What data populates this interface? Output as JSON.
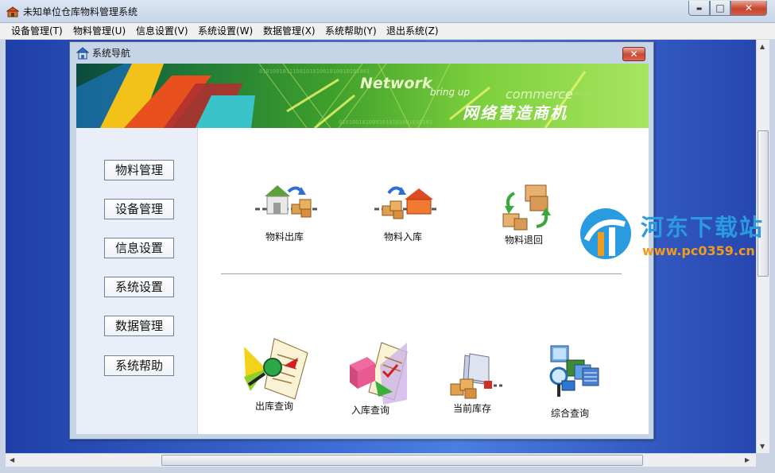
{
  "window": {
    "title": "未知单位仓库物料管理系统",
    "controls": {
      "minimize": "▬",
      "maximize": "□",
      "close": "✕"
    }
  },
  "menu": [
    "设备管理(T)",
    "物料管理(U)",
    "信息设置(V)",
    "系统设置(W)",
    "数据管理(X)",
    "系统帮助(Y)",
    "退出系统(Z)"
  ],
  "nav_dialog": {
    "title": "系统导航",
    "close": "✕",
    "banner": {
      "word1": "Network",
      "word2": "bring up",
      "word3": "commerce",
      "slogan": "网络营造商机"
    },
    "side_buttons": [
      "物料管理",
      "设备管理",
      "信息设置",
      "系统设置",
      "数据管理",
      "系统帮助"
    ],
    "top_row": [
      {
        "label": "物料出库",
        "icon": "warehouse-out-icon"
      },
      {
        "label": "物料入库",
        "icon": "warehouse-in-icon"
      },
      {
        "label": "物料退回",
        "icon": "material-return-icon"
      }
    ],
    "bottom_row": [
      {
        "label": "出库查询",
        "icon": "outbound-query-icon"
      },
      {
        "label": "入库查询",
        "icon": "inbound-query-icon"
      },
      {
        "label": "当前库存",
        "icon": "current-stock-icon"
      },
      {
        "label": "综合查询",
        "icon": "general-query-icon"
      }
    ]
  },
  "watermark": {
    "name": "河东下载站",
    "url": "www.pc0359.cn"
  },
  "colors": {
    "mdi_background": "#3f6fd6",
    "banner_green": "#3fa02c",
    "close_red": "#c8442c"
  }
}
